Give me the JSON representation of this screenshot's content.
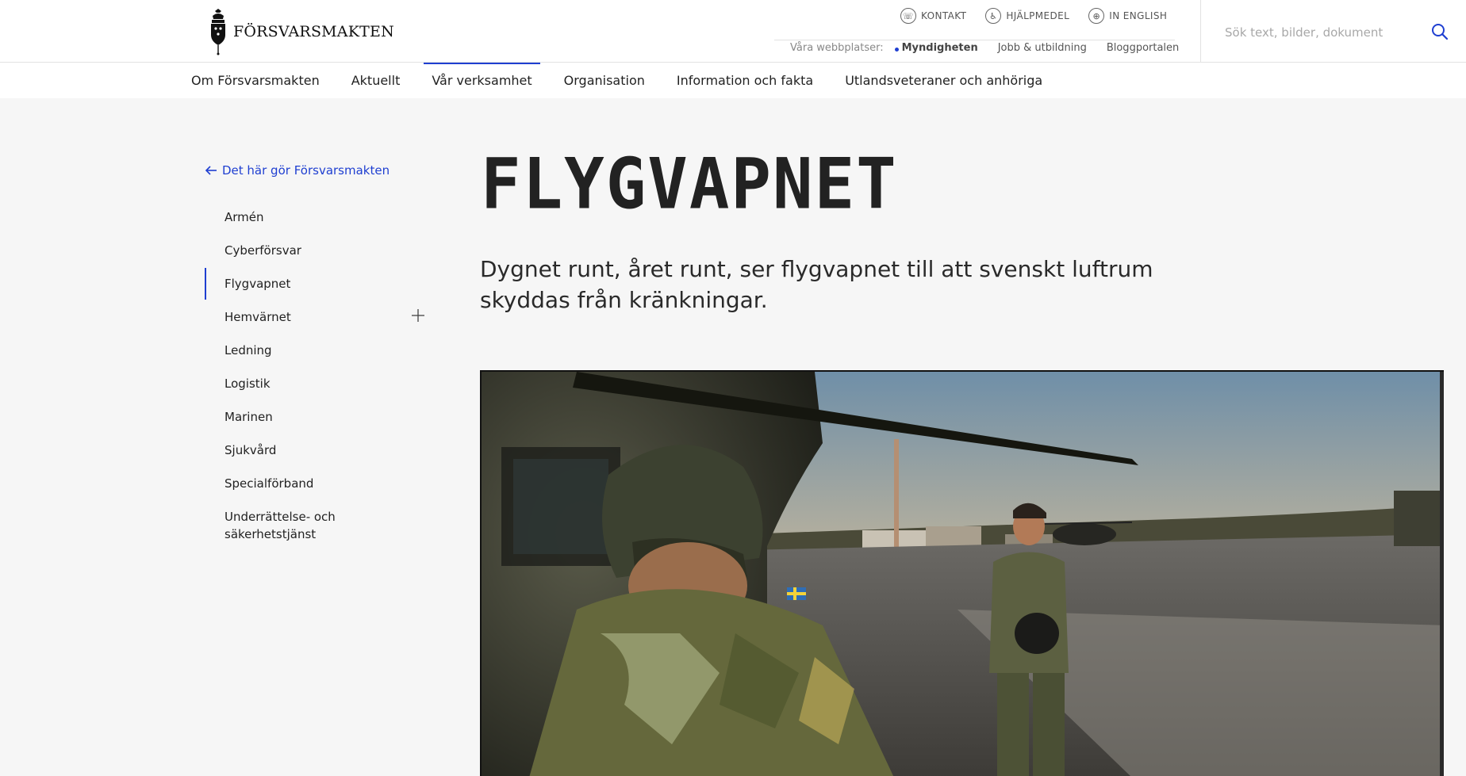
{
  "brand": {
    "name": "FÖRSVARSMAKTEN",
    "logo_icon": "crown-shield-logo-icon"
  },
  "utility": {
    "items": [
      {
        "label": "KONTAKT",
        "icon": "phone-icon"
      },
      {
        "label": "HJÄLPMEDEL",
        "icon": "accessibility-icon"
      },
      {
        "label": "IN ENGLISH",
        "icon": "globe-icon"
      }
    ]
  },
  "sites": {
    "label": "Våra webbplatser:",
    "links": [
      "Myndigheten",
      "Jobb & utbildning",
      "Bloggportalen"
    ],
    "active": "Myndigheten"
  },
  "search": {
    "placeholder": "Sök text, bilder, dokument",
    "icon": "search-icon"
  },
  "nav": {
    "items": [
      "Om Försvarsmakten",
      "Aktuellt",
      "Vår verksamhet",
      "Organisation",
      "Information och fakta",
      "Utlandsveteraner och anhöriga"
    ],
    "active": "Vår verksamhet"
  },
  "sidebar": {
    "back_label": "Det här gör Försvarsmakten",
    "items": [
      "Armén",
      "Cyberförsvar",
      "Flygvapnet",
      "Hemvärnet",
      "Ledning",
      "Logistik",
      "Marinen",
      "Sjukvård",
      "Specialförband",
      "Underrättelse- och säkerhetstjänst"
    ],
    "active": "Flygvapnet",
    "expandable": "Hemvärnet"
  },
  "main": {
    "title": "FLYGVAPNET",
    "lead": "Dygnet runt, året runt, ser flygvapnet till att svenskt luftrum skyddas från kränkningar."
  },
  "colors": {
    "accent": "#1f3fd1",
    "background": "#f6f6f6",
    "text": "#222222"
  }
}
